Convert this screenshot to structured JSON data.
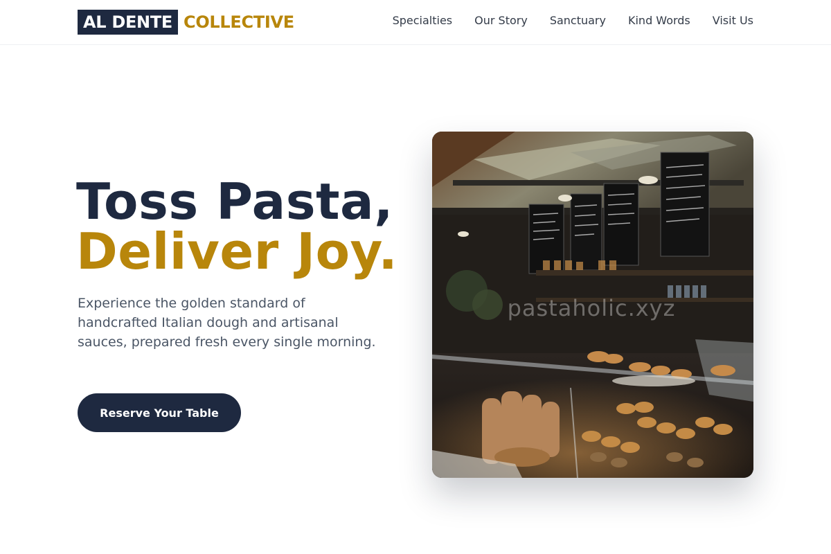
{
  "brand": {
    "name_box": "AL DENTE",
    "name_accent": "COLLECTIVE"
  },
  "nav": {
    "items": [
      {
        "label": "Specialties"
      },
      {
        "label": "Our Story"
      },
      {
        "label": "Sanctuary"
      },
      {
        "label": "Kind Words"
      },
      {
        "label": "Visit Us"
      }
    ]
  },
  "hero": {
    "title_line1": "Toss Pasta,",
    "title_line2": "Deliver Joy.",
    "subtitle": "Experience the golden standard of handcrafted Italian dough and artisanal sauces, prepared fresh every single morning.",
    "cta_label": "Reserve Your Table",
    "image_watermark": "pastaholic.xyz"
  },
  "colors": {
    "primary": "#1e2940",
    "accent": "#b8860b",
    "body_text": "#4a5565"
  }
}
